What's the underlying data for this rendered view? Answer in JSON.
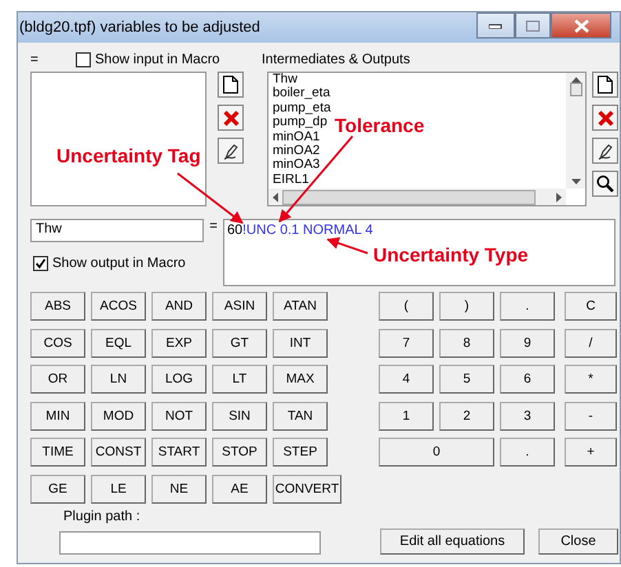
{
  "window": {
    "title": "(bldg20.tpf)  variables to be adjusted"
  },
  "input_panel": {
    "equals_mark": "=",
    "show_in_macro": {
      "label": "Show input in Macro",
      "checked": false
    }
  },
  "outputs_panel": {
    "label": "Intermediates & Outputs",
    "items": [
      "Thw",
      "boiler_eta",
      "pump_eta",
      "pump_dp",
      "minOA1",
      "minOA2",
      "minOA3",
      "EIRL1"
    ]
  },
  "variable": {
    "name": "Thw",
    "equals_mark": "=",
    "show_in_macro": {
      "label": "Show output in Macro",
      "checked": true
    }
  },
  "equation": {
    "value": "60",
    "tag": "!UNC 0.1 NORMAL 4"
  },
  "function_keys": [
    [
      "ABS",
      "ACOS",
      "AND",
      "ASIN",
      "ATAN"
    ],
    [
      "COS",
      "EQL",
      "EXP",
      "GT",
      "INT"
    ],
    [
      "OR",
      "LN",
      "LOG",
      "LT",
      "MAX"
    ],
    [
      "MIN",
      "MOD",
      "NOT",
      "SIN",
      "TAN"
    ],
    [
      "TIME",
      "CONST",
      "START",
      "STOP",
      "STEP"
    ],
    [
      "GE",
      "LE",
      "NE",
      "AE",
      "CONVERT"
    ]
  ],
  "number_keys": [
    [
      {
        "label": "(",
        "kind": "key"
      },
      {
        "label": ")",
        "kind": "key"
      },
      {
        "label": ".",
        "kind": "key"
      },
      {
        "label": "C",
        "kind": "key"
      }
    ],
    [
      {
        "label": "7",
        "kind": "key"
      },
      {
        "label": "8",
        "kind": "key"
      },
      {
        "label": "9",
        "kind": "key"
      },
      {
        "label": "/",
        "kind": "key"
      }
    ],
    [
      {
        "label": "4",
        "kind": "key"
      },
      {
        "label": "5",
        "kind": "key"
      },
      {
        "label": "6",
        "kind": "key"
      },
      {
        "label": "*",
        "kind": "key"
      }
    ],
    [
      {
        "label": "1",
        "kind": "key"
      },
      {
        "label": "2",
        "kind": "key"
      },
      {
        "label": "3",
        "kind": "key"
      },
      {
        "label": "-",
        "kind": "key"
      }
    ],
    [
      {
        "label": "0",
        "kind": "wide"
      },
      {
        "label": ".",
        "kind": "key"
      },
      {
        "label": "+",
        "kind": "key"
      }
    ]
  ],
  "plugin": {
    "label": "Plugin path :"
  },
  "buttons": [
    "Edit all equations",
    "Close"
  ],
  "annotations": [
    {
      "text": "Uncertainty Tag",
      "kind": "tag"
    },
    {
      "text": "Tolerance",
      "kind": "tolerance"
    },
    {
      "text": "Uncertainty Type",
      "kind": "type"
    }
  ]
}
